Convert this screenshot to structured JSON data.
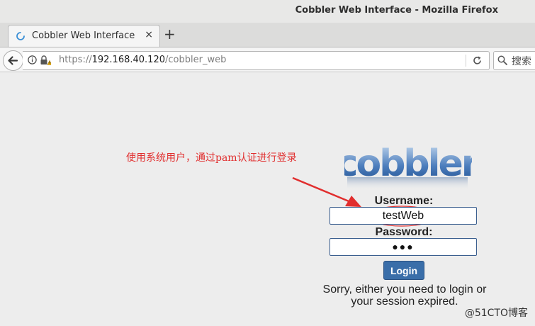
{
  "window": {
    "title": "Cobbler Web Interface - Mozilla Firefox"
  },
  "tab": {
    "label": "Cobbler Web Interface",
    "close_glyph": "×",
    "new_tab_glyph": "+"
  },
  "navbar": {
    "url_scheme": "https://",
    "url_host": "192.168.40.120",
    "url_path": "/cobbler_web",
    "search_placeholder": "搜索"
  },
  "annotation": {
    "text": "使用系统用户，通过pam认证进行登录",
    "color": "#e12e2e"
  },
  "login": {
    "logo_text": "cobbler",
    "username_label": "Username:",
    "username_value": "testWeb",
    "password_label": "Password:",
    "password_mask": "●●●",
    "button_label": "Login",
    "message_line1": "Sorry, either you need to login or",
    "message_line2": "your session expired."
  },
  "watermark": "@51CTO博客",
  "colors": {
    "accent": "#3a6ea9",
    "field_border": "#3b5f8f",
    "annotation": "#e12e2e"
  }
}
